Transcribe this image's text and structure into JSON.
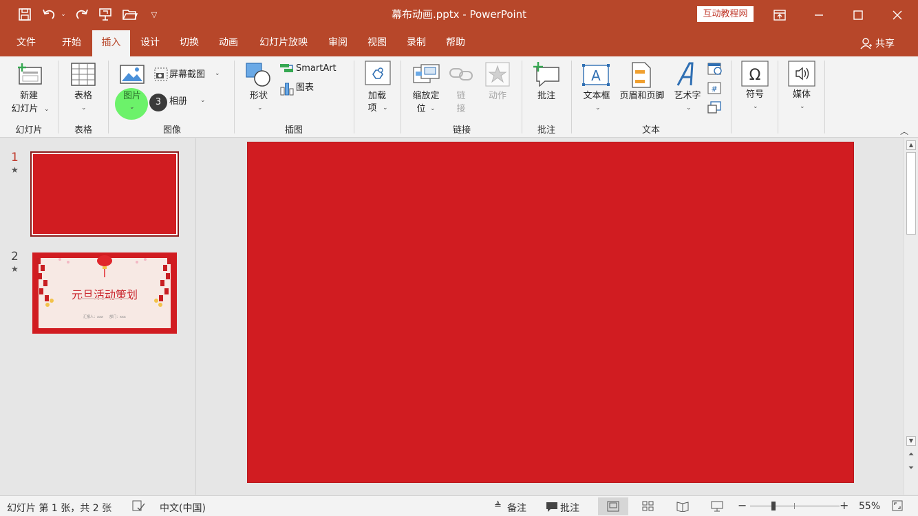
{
  "window": {
    "title": "幕布动画.pptx  -  PowerPoint",
    "site_badge": "互动教程网"
  },
  "tabs": [
    "文件",
    "开始",
    "插入",
    "设计",
    "切换",
    "动画",
    "幻灯片放映",
    "审阅",
    "视图",
    "录制",
    "帮助"
  ],
  "active_tab": "插入",
  "share_label": "共享",
  "ribbon": {
    "new_slide": [
      "新建",
      "幻灯片"
    ],
    "table": "表格",
    "picture": "图片",
    "screenshot": "屏幕截图",
    "album": "相册",
    "shapes": "形状",
    "smartart": "SmartArt",
    "chart": "图表",
    "addins": [
      "加载",
      "项"
    ],
    "zoom": [
      "缩放定",
      "位"
    ],
    "link": [
      "链",
      "接"
    ],
    "action": "动作",
    "comment": "批注",
    "textbox": "文本框",
    "header_footer": "页眉和页脚",
    "wordart": "艺术字",
    "symbol": "符号",
    "media": "媒体",
    "groups": {
      "slides": "幻灯片",
      "tables": "表格",
      "images": "图像",
      "illustrations": "插图",
      "links": "链接",
      "comments": "批注",
      "text": "文本"
    },
    "step_marker": "3"
  },
  "slides": [
    {
      "number": "1"
    },
    {
      "number": "2",
      "title": "元旦活动策划",
      "meta_left": "汇报人：xxx",
      "meta_right": "部门：xxx"
    }
  ],
  "status": {
    "slide_info": "幻灯片 第 1 张，共 2 张",
    "language": "中文(中国)",
    "notes": "备注",
    "comments": "批注",
    "zoom": "55%"
  },
  "colors": {
    "accent": "#b7472a",
    "slide_fill": "#d11c21",
    "highlight": "#6cf26a"
  }
}
